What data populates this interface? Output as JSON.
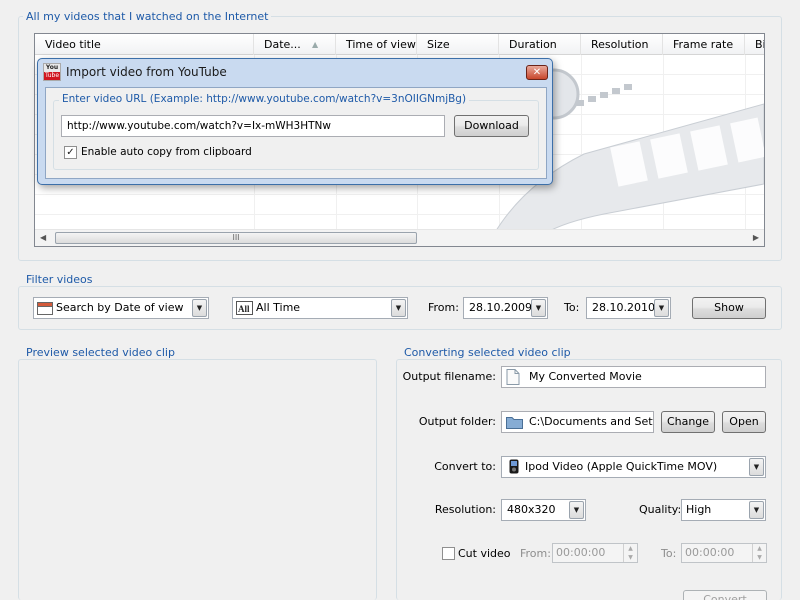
{
  "videos_group": {
    "title": "All my videos that I watched on the Internet",
    "columns": [
      "Video title",
      "Date...",
      "Time of view",
      "Size",
      "Duration",
      "Resolution",
      "Frame rate",
      "Bi"
    ],
    "scroll_thumb_grip": "III"
  },
  "import_dialog": {
    "title": "Import video from YouTube",
    "icon_label_top": "You",
    "icon_label_bottom": "Tube",
    "close_glyph": "✕",
    "url_label": "Enter video URL (Example: http://www.youtube.com/watch?v=3nOIIGNmjBg)",
    "url_value": "http://www.youtube.com/watch?v=Ix-mWH3HTNw",
    "download_label": "Download",
    "auto_copy_label": "Enable auto copy from clipboard",
    "auto_copy_checked": true
  },
  "filter": {
    "title": "Filter videos",
    "search_mode": "Search by Date of view",
    "period": "All Time",
    "from_label": "From:",
    "from_value": "28.10.2009",
    "to_label": "To:",
    "to_value": "28.10.2010",
    "show_label": "Show"
  },
  "preview": {
    "title": "Preview selected video clip"
  },
  "converting": {
    "title": "Converting selected video clip",
    "output_filename_label": "Output filename:",
    "output_filename_value": "My Converted Movie",
    "output_folder_label": "Output folder:",
    "output_folder_value": "C:\\Documents and Settir",
    "change_label": "Change",
    "open_label": "Open",
    "convert_to_label": "Convert to:",
    "convert_to_value": "Ipod Video (Apple QuickTime MOV)",
    "resolution_label": "Resolution:",
    "resolution_value": "480x320",
    "quality_label": "Quality:",
    "quality_value": "High",
    "cut_video_label": "Cut video",
    "cut_video_checked": false,
    "cut_from_label": "From:",
    "cut_from_value": "00:00:00",
    "cut_to_label": "To:",
    "cut_to_value": "00:00:00",
    "convert_label": "Convert"
  },
  "icons": {
    "dropdown": "▼",
    "sort_asc": "▲",
    "scroll_left": "◀",
    "scroll_right": "▶",
    "spin_up": "▲",
    "spin_down": "▼",
    "check": "✓"
  },
  "colors": {
    "group_title": "#1e5aa8",
    "dialog_frame": "#c9daf0",
    "close_button": "#c8462c"
  }
}
